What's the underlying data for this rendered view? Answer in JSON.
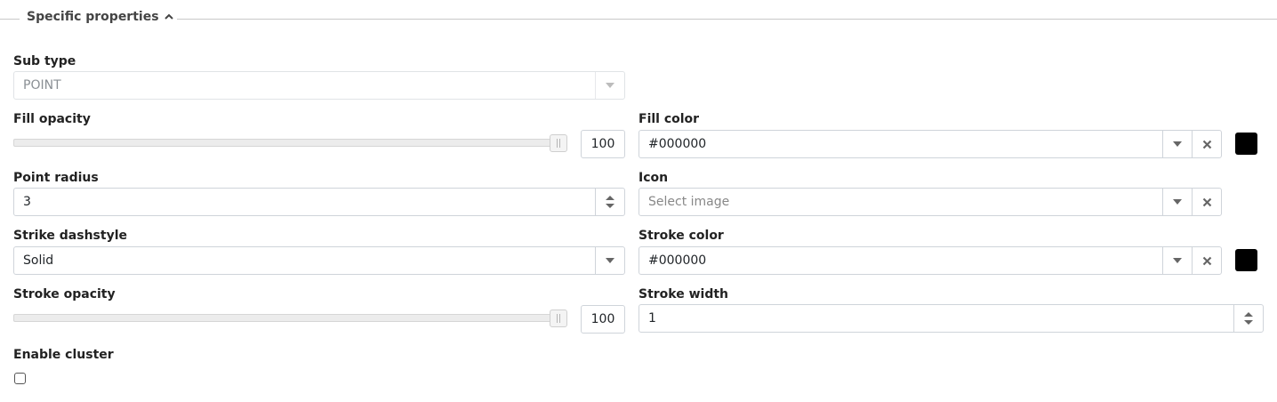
{
  "section": {
    "title": "Specific properties",
    "expanded_icon": "chevron-up-icon"
  },
  "sub_type": {
    "label": "Sub type",
    "value": "POINT"
  },
  "fill_opacity": {
    "label": "Fill opacity",
    "value": "100",
    "slider_fraction": 1.0
  },
  "fill_color": {
    "label": "Fill color",
    "value": "#000000",
    "swatch_color": "#000000"
  },
  "point_radius": {
    "label": "Point radius",
    "value": "3"
  },
  "icon": {
    "label": "Icon",
    "placeholder": "Select image"
  },
  "strike_dashstyle": {
    "label": "Strike dashstyle",
    "value": "Solid"
  },
  "stroke_color": {
    "label": "Stroke color",
    "value": "#000000",
    "swatch_color": "#000000"
  },
  "stroke_opacity": {
    "label": "Stroke opacity",
    "value": "100",
    "slider_fraction": 1.0
  },
  "stroke_width": {
    "label": "Stroke width",
    "value": "1"
  },
  "enable_cluster": {
    "label": "Enable cluster",
    "checked": false
  },
  "icons": {
    "dropdown": "caret-down-icon",
    "clear": "x-icon",
    "spinner": "spinner-arrows-icon"
  }
}
